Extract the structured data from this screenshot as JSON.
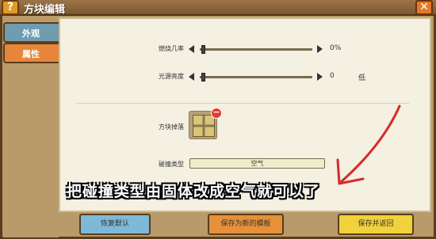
{
  "window": {
    "title": "方块编辑"
  },
  "titlebar": {
    "help_label": "?",
    "close_label": "✕"
  },
  "sidebar": {
    "tabs": [
      {
        "label": "外观"
      },
      {
        "label": "属性"
      }
    ]
  },
  "attributes": {
    "burn_chance": {
      "label": "燃烧几率",
      "value": "0%",
      "level": 0
    },
    "light_brightness": {
      "label": "光源亮度",
      "value": "0",
      "extra": "低",
      "level": 0
    },
    "block_drop": {
      "label": "方块掉落",
      "remove_label": "−"
    },
    "collision_type": {
      "label": "碰撞类型",
      "value": "空气"
    }
  },
  "overlay": {
    "caption": "把碰撞类型由固体改成空气就可以了",
    "arrow_color": "#d62a2a"
  },
  "footer": {
    "restore_label": "恢复默认",
    "save_template_label": "保存为新的模板",
    "save_return_label": "保存并返回"
  },
  "colors": {
    "tab_active": "#e7863a",
    "tab_inactive": "#6f9cae",
    "panel_bg": "#f4f0e2"
  }
}
